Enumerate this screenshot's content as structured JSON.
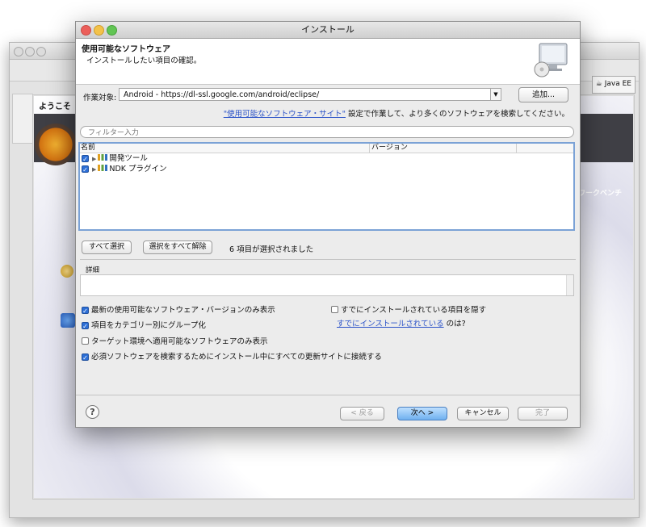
{
  "background_app": {
    "welcome_tab": "ようこそ",
    "perspective": "Java EE",
    "workbench_label": "ワークベンチ"
  },
  "dialog": {
    "title": "インストール",
    "header": {
      "title": "使用可能なソフトウェア",
      "subtitle": "インストールしたい項目の確認。"
    },
    "work_with": {
      "label": "作業対象:",
      "value": "Android - https://dl-ssl.google.com/android/eclipse/",
      "add_label": "追加..."
    },
    "sites_link": "\"使用可能なソフトウェア・サイト\"",
    "sites_text": " 設定で作業して、より多くのソフトウェアを検索してください。",
    "filter_placeholder": "フィルター入力",
    "tree": {
      "col_name": "名前",
      "col_version": "バージョン",
      "rows": [
        {
          "label": "開発ツール",
          "checked": true
        },
        {
          "label": "NDK プラグイン",
          "checked": true
        }
      ]
    },
    "select_all_label": "すべて選択",
    "deselect_all_label": "選択をすべて解除",
    "selected_count": "6 項目が選択されました",
    "details_label": "詳細",
    "options": {
      "latest_only": "最新の使用可能なソフトウェア・バージョンのみ表示",
      "group_by_category": "項目をカテゴリー別にグループ化",
      "target_env_only": "ターゲット環境へ適用可能なソフトウェアのみ表示",
      "contact_all_sites": "必須ソフトウェアを検索するためにインストール中にすべての更新サイトに接続する",
      "hide_installed": "すでにインストールされている項目を隠す",
      "installed_link": "すでにインストールされている",
      "installed_suffix": " のは?"
    },
    "buttons": {
      "back": "< 戻る",
      "next": "次へ >",
      "cancel": "キャンセル",
      "finish": "完了"
    }
  }
}
